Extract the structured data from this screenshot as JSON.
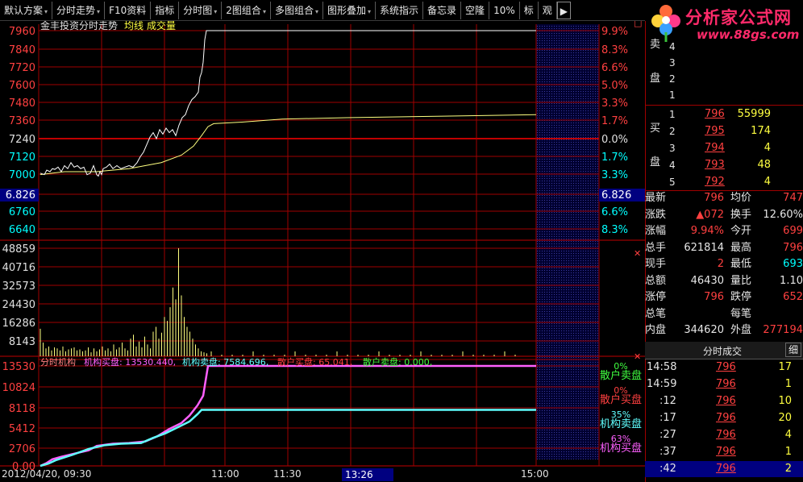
{
  "toolbar": {
    "items": [
      "默认方案",
      "分时走势",
      "F10资料",
      "指标",
      "分时图",
      "2图组合",
      "多图组合",
      "图形叠加",
      "系统指示",
      "备忘录",
      "空隆",
      "10%",
      "标",
      "观"
    ]
  },
  "logo": {
    "brand": "分析家公式网",
    "url": "www.88gs.com"
  },
  "chart": {
    "title": "金丰投资分时走势",
    "avg_label": "均线",
    "vol_label": "成交量",
    "price_ticks": [
      "7960",
      "7840",
      "7720",
      "7600",
      "7480",
      "7360",
      "7240",
      "7120",
      "7000",
      "6.826",
      "6760",
      "6640"
    ],
    "pct_ticks": [
      "9.9%",
      "8.3%",
      "6.6%",
      "5.0%",
      "3.3%",
      "1.7%",
      "0.0%",
      "1.7%",
      "3.3%",
      "6.826",
      "6.6%",
      "8.3%"
    ],
    "vol_ticks": [
      "48859",
      "40716",
      "32573",
      "24430",
      "16286",
      "8143"
    ],
    "ind_ticks": [
      "13530",
      "10824",
      "8118",
      "5412",
      "2706",
      "0.00"
    ],
    "ind_header": {
      "name": "分时机构",
      "s1": "机构买盘: 13530.440,",
      "s2": "机构卖盘: 7584.696,",
      "s3": "散户买盘: 65.041,",
      "s4": "散户卖盘: 0.000,"
    },
    "ind_side": [
      {
        "pct": "0%",
        "label": "散户卖盘"
      },
      {
        "pct": "0%",
        "label": "散户买盘"
      },
      {
        "pct": "35%",
        "label": "机构卖盘"
      },
      {
        "pct": "63%",
        "label": "机构买盘"
      }
    ],
    "time_axis": {
      "date": "2012/04/20, 09:30",
      "t1": "11:00",
      "t2": "11:30",
      "cursor": "13:26",
      "t3": "15:00"
    },
    "colors": {
      "up": "#ff3030",
      "grid": "#a00000",
      "price": "#ffffff",
      "avg": "#ffff80",
      "vol": "#ffff80",
      "inst_buy": "#ff60ff",
      "inst_sell": "#60ffff"
    }
  },
  "chart_data": {
    "type": "line",
    "price_path": [
      [
        0,
        7010
      ],
      [
        5,
        7000
      ],
      [
        8,
        7030
      ],
      [
        12,
        7020
      ],
      [
        15,
        7040
      ],
      [
        18,
        7035
      ],
      [
        22,
        7050
      ],
      [
        26,
        7020
      ],
      [
        30,
        7060
      ],
      [
        34,
        7040
      ],
      [
        38,
        7080
      ],
      [
        42,
        7050
      ],
      [
        46,
        7060
      ],
      [
        50,
        7040
      ],
      [
        54,
        7050
      ],
      [
        58,
        7000
      ],
      [
        62,
        7010
      ],
      [
        66,
        7060
      ],
      [
        70,
        7000
      ],
      [
        72,
        6990
      ],
      [
        74,
        7020
      ],
      [
        76,
        7000
      ],
      [
        78,
        7040
      ],
      [
        82,
        7050
      ],
      [
        86,
        7070
      ],
      [
        90,
        7040
      ],
      [
        95,
        7060
      ],
      [
        100,
        7040
      ],
      [
        105,
        7050
      ],
      [
        110,
        7060
      ],
      [
        115,
        7050
      ],
      [
        120,
        7080
      ],
      [
        124,
        7120
      ],
      [
        128,
        7150
      ],
      [
        132,
        7200
      ],
      [
        136,
        7250
      ],
      [
        140,
        7280
      ],
      [
        144,
        7240
      ],
      [
        148,
        7300
      ],
      [
        152,
        7270
      ],
      [
        156,
        7310
      ],
      [
        160,
        7280
      ],
      [
        164,
        7300
      ],
      [
        168,
        7260
      ],
      [
        172,
        7330
      ],
      [
        176,
        7380
      ],
      [
        180,
        7400
      ],
      [
        184,
        7460
      ],
      [
        188,
        7500
      ],
      [
        192,
        7520
      ],
      [
        196,
        7550
      ],
      [
        198,
        7650
      ],
      [
        200,
        7680
      ],
      [
        202,
        7750
      ],
      [
        204,
        7900
      ],
      [
        206,
        7960
      ],
      [
        615,
        7960
      ]
    ],
    "avg_path": [
      [
        0,
        7000
      ],
      [
        30,
        7020
      ],
      [
        70,
        7020
      ],
      [
        110,
        7040
      ],
      [
        150,
        7080
      ],
      [
        175,
        7130
      ],
      [
        190,
        7190
      ],
      [
        200,
        7260
      ],
      [
        208,
        7320
      ],
      [
        215,
        7340
      ],
      [
        250,
        7350
      ],
      [
        300,
        7370
      ],
      [
        380,
        7380
      ],
      [
        500,
        7390
      ],
      [
        615,
        7400
      ]
    ],
    "volume": [
      28,
      14,
      8,
      10,
      6,
      9,
      8,
      6,
      10,
      5,
      7,
      8,
      9,
      6,
      7,
      5,
      6,
      9,
      4,
      8,
      5,
      7,
      10,
      6,
      8,
      5,
      12,
      7,
      9,
      14,
      8,
      6,
      18,
      22,
      10,
      15,
      9,
      20,
      12,
      8,
      25,
      30,
      18,
      24,
      40,
      36,
      50,
      70,
      58,
      110,
      62,
      40,
      30,
      25,
      18,
      12,
      8,
      5,
      4,
      3
    ],
    "inst_buy_path": [
      [
        0,
        0
      ],
      [
        8,
        400
      ],
      [
        15,
        900
      ],
      [
        25,
        1200
      ],
      [
        40,
        1600
      ],
      [
        60,
        2100
      ],
      [
        70,
        2700
      ],
      [
        90,
        3000
      ],
      [
        110,
        3100
      ],
      [
        130,
        3300
      ],
      [
        145,
        4000
      ],
      [
        160,
        5000
      ],
      [
        175,
        5800
      ],
      [
        185,
        6800
      ],
      [
        195,
        8200
      ],
      [
        202,
        9500
      ],
      [
        208,
        13530
      ],
      [
        615,
        13530
      ]
    ],
    "inst_sell_path": [
      [
        0,
        0
      ],
      [
        10,
        300
      ],
      [
        20,
        800
      ],
      [
        40,
        1500
      ],
      [
        60,
        2300
      ],
      [
        80,
        2800
      ],
      [
        100,
        3000
      ],
      [
        125,
        3100
      ],
      [
        140,
        3800
      ],
      [
        155,
        4400
      ],
      [
        170,
        5200
      ],
      [
        185,
        6000
      ],
      [
        195,
        7000
      ],
      [
        200,
        7584
      ],
      [
        615,
        7584
      ]
    ]
  },
  "right_panel": {
    "sell_label": [
      "卖",
      "盘"
    ],
    "sell_levels": [
      "4",
      "3",
      "2",
      "1"
    ],
    "buy_label": [
      "买",
      "盘"
    ],
    "buy_rows": [
      {
        "n": "1",
        "price": "796",
        "vol": "55999"
      },
      {
        "n": "2",
        "price": "795",
        "vol": "174"
      },
      {
        "n": "3",
        "price": "794",
        "vol": "4"
      },
      {
        "n": "4",
        "price": "793",
        "vol": "48"
      },
      {
        "n": "5",
        "price": "792",
        "vol": "4"
      }
    ],
    "stats": [
      {
        "l": "最新",
        "v": "796",
        "l2": "均价",
        "v2": "747"
      },
      {
        "l": "涨跌",
        "v": "▲072",
        "l2": "换手",
        "v2": "12.60%"
      },
      {
        "l": "涨幅",
        "v": "9.94%",
        "l2": "今开",
        "v2": "699"
      },
      {
        "l": "总手",
        "v": "621814",
        "l2": "最高",
        "v2": "796"
      },
      {
        "l": "现手",
        "v": "2",
        "l2": "最低",
        "v2": "693"
      },
      {
        "l": "总额",
        "v": "46430",
        "l2": "量比",
        "v2": "1.10"
      },
      {
        "l": "涨停",
        "v": "796",
        "l2": "跌停",
        "v2": "652"
      },
      {
        "l": "总笔",
        "v": "",
        "l2": "每笔",
        "v2": ""
      },
      {
        "l": "内盘",
        "v": "344620",
        "l2": "外盘",
        "v2": "277194"
      }
    ],
    "tick_tab": "分时成交",
    "tick_tab2": "细",
    "ticks": [
      {
        "t": "14:58",
        "p": "796",
        "v": "17"
      },
      {
        "t": "14:59",
        "p": "796",
        "v": "1"
      },
      {
        "t": ":12",
        "p": "796",
        "v": "10"
      },
      {
        "t": ":17",
        "p": "796",
        "v": "20"
      },
      {
        "t": ":27",
        "p": "796",
        "v": "4"
      },
      {
        "t": ":37",
        "p": "796",
        "v": "1"
      },
      {
        "t": ":42",
        "p": "796",
        "v": "2"
      }
    ]
  }
}
